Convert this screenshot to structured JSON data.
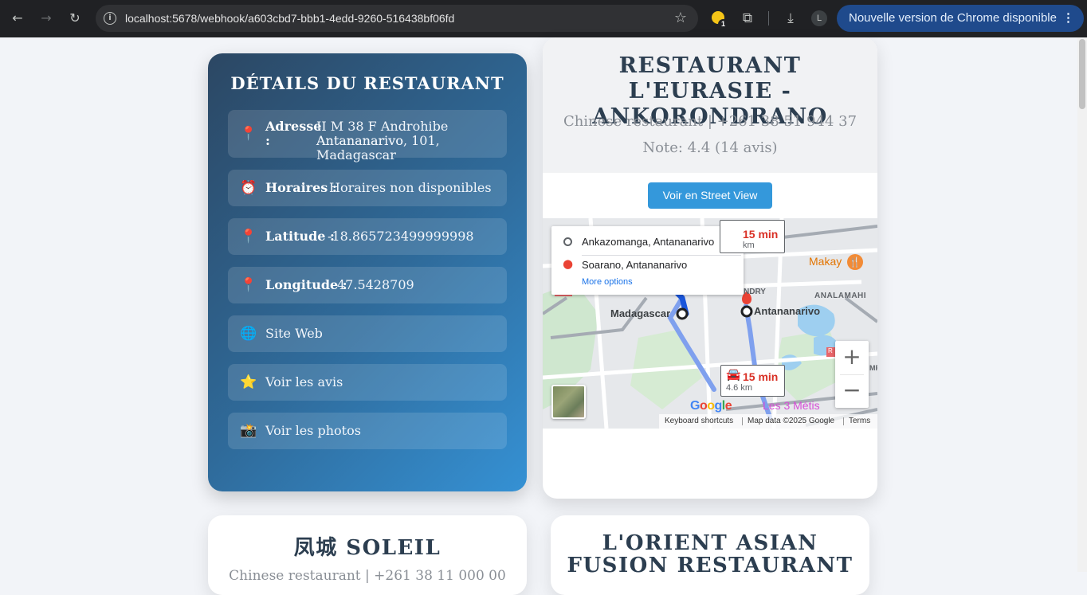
{
  "browser": {
    "url": "localhost:5678/webhook/a603cbd7-bbb1-4edd-9260-516438bf06fd",
    "extension_badge": "1",
    "profile_initial": "L",
    "update_label": "Nouvelle version de Chrome disponible",
    "icons": [
      "back-arrow-icon",
      "forward-arrow-icon",
      "reload-icon",
      "site-info-icon",
      "bookmark-star-icon",
      "extension-icon",
      "puzzle-icon",
      "download-icon",
      "more-vert-icon"
    ]
  },
  "details": {
    "title": "DÉTAILS DU RESTAURANT",
    "address_label": "Adresse :",
    "address_value_line1": "II M 38 F Androhibe Antananarivo",
    "address_value_line2": "Antananarivo, 101, Madagascar",
    "hours_label": "Horaires :",
    "hours_value": "Horaires non disponibles",
    "latitude_label": "Latitude :",
    "latitude_value": "-18.865723499999998",
    "longitude_label": "Longitude :",
    "longitude_value": "47.5428709",
    "website_link": "Site Web",
    "reviews_link": "Voir les avis",
    "photos_link": "Voir les photos",
    "icons": {
      "address": "📍",
      "hours": "⏰",
      "latitude": "📍",
      "longitude": "📍",
      "website": "🌐",
      "reviews": "⭐",
      "photos": "📸"
    }
  },
  "restaurant": {
    "name": "RESTAURANT L'EURASIE - ANKORONDRANO",
    "subtitle": "Chinese restaurant | +261 38 51 944 37",
    "rating": "Note: 4.4 (14 avis)",
    "street_view_button": "Voir en Street View"
  },
  "map": {
    "origin": "Ankazomanga, Antananarivo",
    "destination": "Soarano, Antananarivo",
    "more_options": "More options",
    "route_time_top": "15 min",
    "route_dist_top": "km",
    "route_time_bottom": "15 min",
    "route_dist_bottom": "4.6 km",
    "labels": {
      "madagascar": "Madagascar",
      "antananarivo": "Antananarivo",
      "makay": "Makay",
      "analamahi": "ANALAMAHI",
      "ndry": "NDRY",
      "les3metis": "Les 3 Métis",
      "r_marker": "R",
      "mp": "MP"
    },
    "google_logo": "Google",
    "attribution": {
      "shortcuts": "Keyboard shortcuts",
      "data": "Map data ©2025 Google",
      "terms": "Terms"
    },
    "zoom_in": "+",
    "zoom_out": "−"
  },
  "bottom_cards": [
    {
      "title": "凤城 SOLEIL",
      "subtitle": "Chinese restaurant | +261 38 11 000 00"
    },
    {
      "title": "L'ORIENT ASIAN FUSION RESTAURANT"
    }
  ],
  "colors": {
    "accent_blue": "#3498db",
    "dark_title": "#2c3e50",
    "route_red": "#d93025"
  }
}
